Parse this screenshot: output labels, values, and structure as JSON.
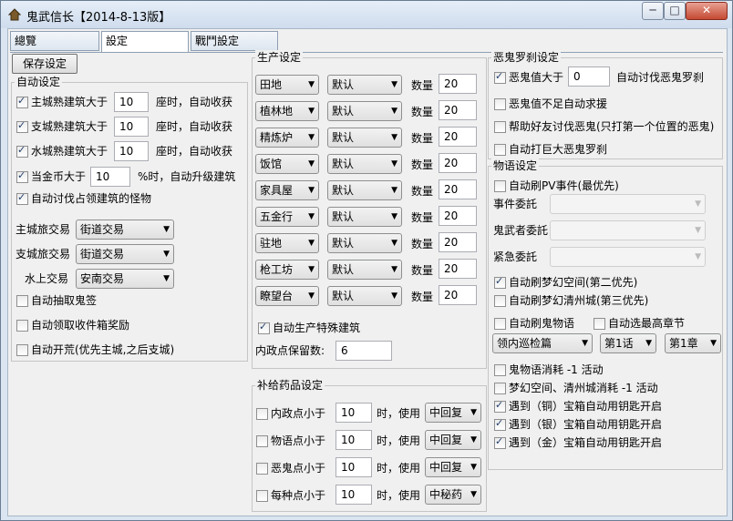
{
  "window": {
    "title": "鬼武信长【2014-8-13版】"
  },
  "tabs": [
    "總覽",
    "設定",
    "戰鬥設定"
  ],
  "left": {
    "save_label": "保存设定",
    "group_title": "自动设定",
    "rows": [
      {
        "label": "主城熟建筑大于",
        "value": "10",
        "suffix": "座时，自动收获",
        "checked": true
      },
      {
        "label": "支城熟建筑大于",
        "value": "10",
        "suffix": "座时，自动收获",
        "checked": true
      },
      {
        "label": "水城熟建筑大于",
        "value": "10",
        "suffix": "座时，自动收获",
        "checked": true
      }
    ],
    "gold": {
      "label": "当金币大于",
      "value": "10",
      "suffix": "%时，自动升级建筑",
      "checked": true
    },
    "monster": {
      "label": "自动讨伐占领建筑的怪物",
      "checked": true
    },
    "trades": [
      {
        "label": "主城旅交易",
        "value": "街道交易"
      },
      {
        "label": "支城旅交易",
        "value": "街道交易"
      },
      {
        "label": "水上交易",
        "value": "安南交易"
      }
    ],
    "checks": [
      {
        "label": "自动抽取鬼签",
        "checked": false
      },
      {
        "label": "自动领取收件箱奖励",
        "checked": false
      },
      {
        "label": "自动开荒(优先主城,之后支城)",
        "checked": false
      }
    ]
  },
  "production": {
    "title": "生产设定",
    "qty_label": "数量",
    "rows": [
      {
        "building": "田地",
        "mode": "默认",
        "qty": "20"
      },
      {
        "building": "植林地",
        "mode": "默认",
        "qty": "20"
      },
      {
        "building": "精炼炉",
        "mode": "默认",
        "qty": "20"
      },
      {
        "building": "饭馆",
        "mode": "默认",
        "qty": "20"
      },
      {
        "building": "家具屋",
        "mode": "默认",
        "qty": "20"
      },
      {
        "building": "五金行",
        "mode": "默认",
        "qty": "20"
      },
      {
        "building": "驻地",
        "mode": "默认",
        "qty": "20"
      },
      {
        "building": "枪工坊",
        "mode": "默认",
        "qty": "20"
      },
      {
        "building": "瞭望台",
        "mode": "默认",
        "qty": "20"
      }
    ],
    "special": {
      "label": "自动生产特殊建筑",
      "checked": true
    },
    "reserve": {
      "label": "内政点保留数:",
      "value": "6"
    }
  },
  "potions": {
    "title": "补给药品设定",
    "rows": [
      {
        "label": "内政点小于",
        "value": "10",
        "mid": "时，使用",
        "item": "中回复",
        "checked": false
      },
      {
        "label": "物语点小于",
        "value": "10",
        "mid": "时，使用",
        "item": "中回复",
        "checked": false
      },
      {
        "label": "恶鬼点小于",
        "value": "10",
        "mid": "时，使用",
        "item": "中回复",
        "checked": false
      },
      {
        "label": "每种点小于",
        "value": "10",
        "mid": "时，使用",
        "item": "中秘药",
        "checked": false
      }
    ]
  },
  "demon": {
    "title": "恶鬼罗刹设定",
    "rows": [
      {
        "label": "恶鬼值大于",
        "value": "0",
        "suffix": "自动讨伐恶鬼罗刹",
        "checked": true
      },
      {
        "label": "恶鬼值不足自动求援",
        "checked": false
      },
      {
        "label": "帮助好友讨伐恶鬼(只打第一个位置的恶鬼)",
        "checked": false
      },
      {
        "label": "自动打巨大恶鬼罗刹",
        "checked": false
      }
    ]
  },
  "story": {
    "title": "物语设定",
    "pv": {
      "label": "自动刷PV事件(最优先)",
      "checked": false
    },
    "commissions": [
      {
        "label": "事件委託",
        "value": ""
      },
      {
        "label": "鬼武者委託",
        "value": ""
      },
      {
        "label": "紧急委託",
        "value": ""
      }
    ],
    "dream1": {
      "label": "自动刷梦幻空间(第二优先)",
      "checked": true
    },
    "dream2": {
      "label": "自动刷梦幻清州城(第三优先)",
      "checked": false
    },
    "ghost_story": {
      "label": "自动刷鬼物语",
      "checked": false
    },
    "highest": {
      "label": "自动选最高章节",
      "checked": false
    },
    "selects": [
      "领内巡检篇",
      "第1话",
      "第1章"
    ],
    "tail": [
      {
        "label": "鬼物语消耗 -1 活动",
        "checked": false
      },
      {
        "label": "梦幻空间、清州城消耗 -1 活动",
        "checked": false
      },
      {
        "label": "遇到（铜）宝箱自动用钥匙开启",
        "checked": true
      },
      {
        "label": "遇到（银）宝箱自动用钥匙开启",
        "checked": true
      },
      {
        "label": "遇到（金）宝箱自动用钥匙开启",
        "checked": true
      }
    ]
  },
  "icons": {
    "app": "house-icon",
    "arrow": "▼"
  }
}
